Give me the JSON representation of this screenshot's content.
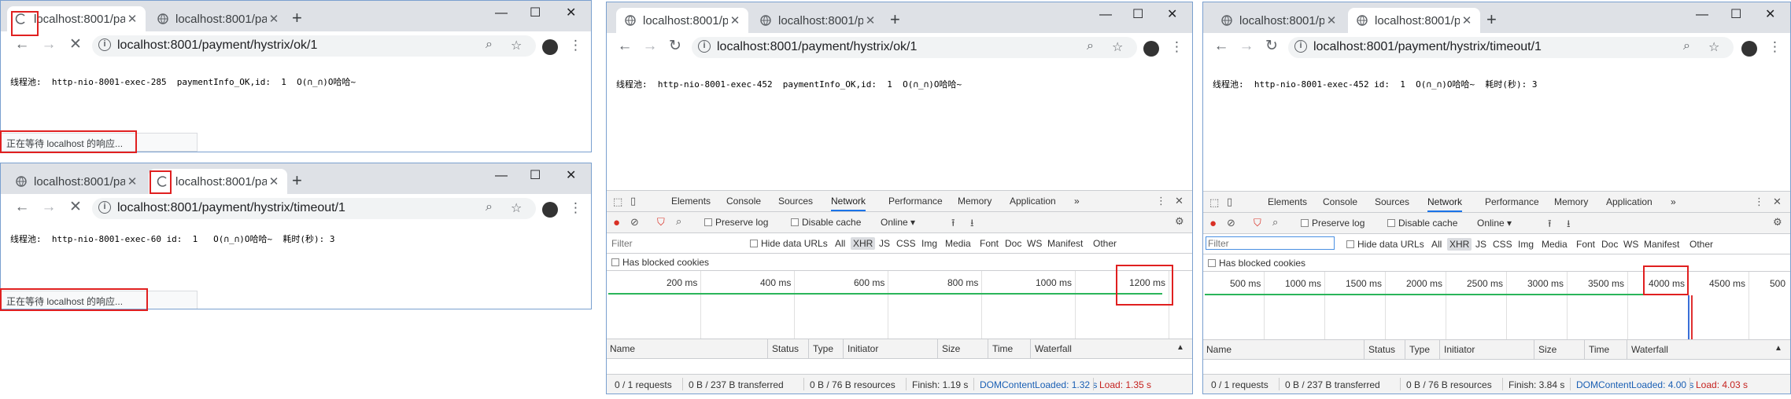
{
  "browser": {
    "tab_title": "localhost:8001/pa",
    "url_ok": "localhost:8001/payment/hystrix/ok/1",
    "url_timeout": "localhost:8001/payment/hystrix/timeout/1",
    "waiting_text": "正在等待 localhost 的响应..."
  },
  "pages": {
    "w1_text": "线程池:  http-nio-8001-exec-285  paymentInfo_OK,id:  1  O(∩_∩)O哈哈~",
    "w2_text": "线程池:  http-nio-8001-exec-60 id:  1   O(∩_∩)O哈哈~  耗时(秒): 3",
    "w3_text": "线程池:  http-nio-8001-exec-452  paymentInfo_OK,id:  1  O(∩_∩)O哈哈~",
    "w4_text": "线程池:  http-nio-8001-exec-452 id:  1  O(∩_∩)O哈哈~  耗时(秒): 3"
  },
  "devtools": {
    "tabs": [
      "Elements",
      "Console",
      "Sources",
      "Network",
      "Performance",
      "Memory",
      "Application"
    ],
    "more": "»",
    "preserve_log": "Preserve log",
    "disable_cache": "Disable cache",
    "throttle": "Online",
    "filter_placeholder": "Filter",
    "hide_data_urls": "Hide data URLs",
    "types": [
      "All",
      "XHR",
      "JS",
      "CSS",
      "Img",
      "Media",
      "Font",
      "Doc",
      "WS",
      "Manifest",
      "Other"
    ],
    "has_blocked_cookies": "Has blocked cookies",
    "columns": [
      "Name",
      "Status",
      "Type",
      "Initiator",
      "Size",
      "Time",
      "Waterfall"
    ],
    "ticks_a": [
      "200 ms",
      "400 ms",
      "600 ms",
      "800 ms",
      "1000 ms",
      "1200 ms"
    ],
    "ticks_b": [
      "500 ms",
      "1000 ms",
      "1500 ms",
      "2000 ms",
      "2500 ms",
      "3000 ms",
      "3500 ms",
      "4000 ms",
      "4500 ms",
      "500"
    ],
    "summary_a": {
      "requests": "0 / 1 requests",
      "transferred": "0 B / 237 B transferred",
      "resources": "0 B / 76 B resources",
      "finish": "Finish: 1.19 s",
      "dcl": "DOMContentLoaded: 1.32 s",
      "load": "Load: 1.35 s"
    },
    "summary_b": {
      "requests": "0 / 1 requests",
      "transferred": "0 B / 237 B transferred",
      "resources": "0 B / 76 B resources",
      "finish": "Finish: 3.84 s",
      "dcl": "DOMContentLoaded: 4.00 s",
      "load": "Load: 4.03 s"
    }
  }
}
